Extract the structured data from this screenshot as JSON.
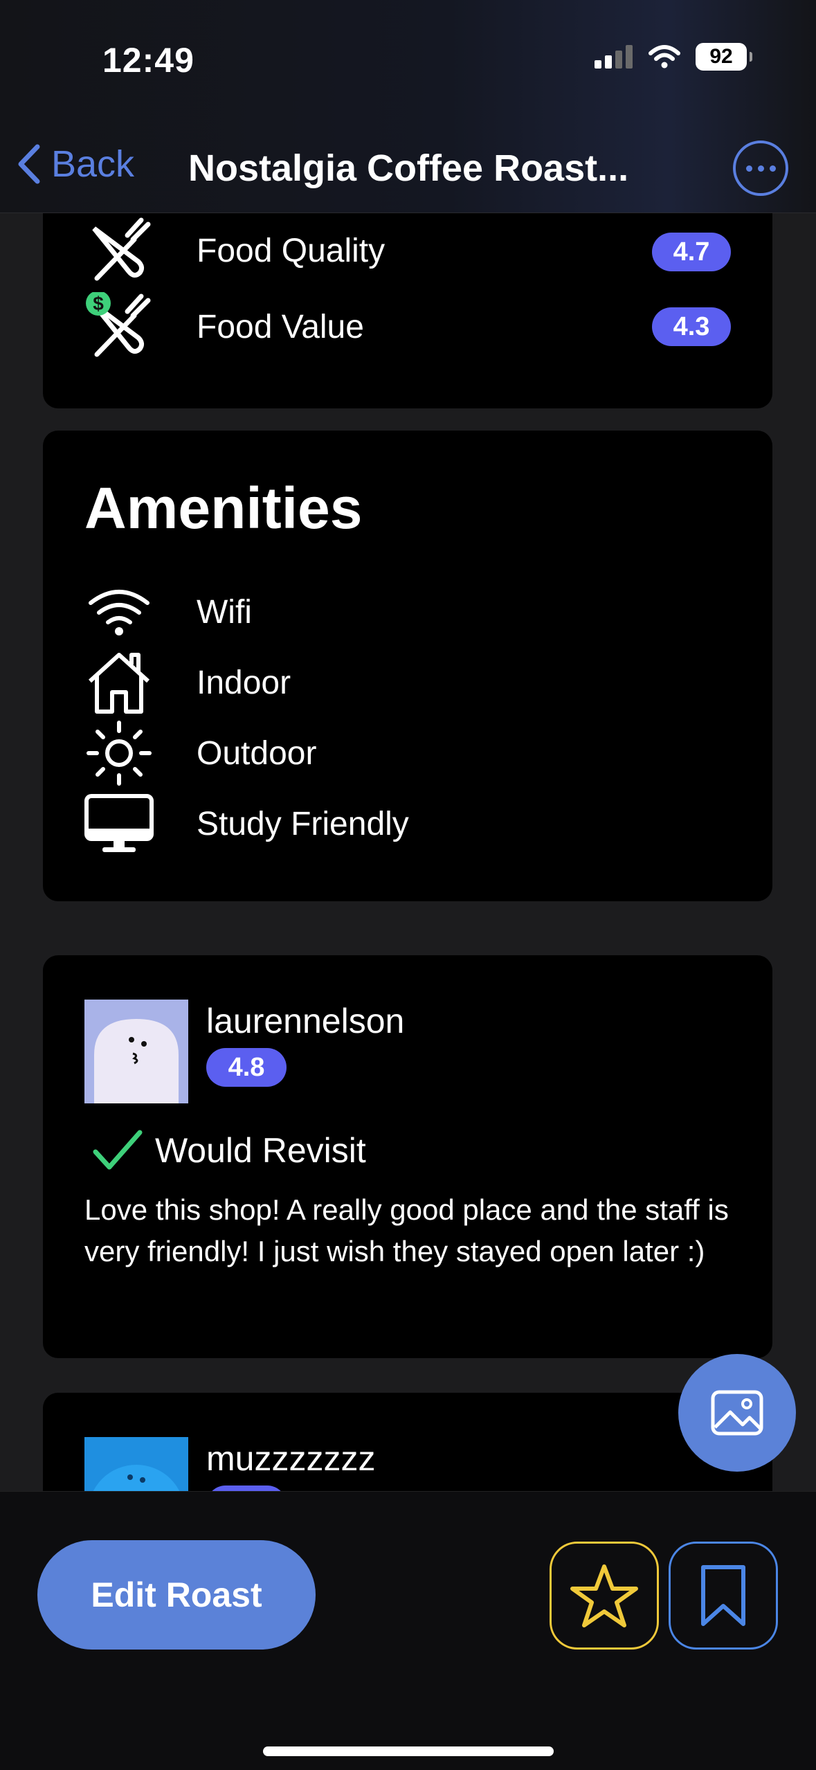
{
  "status_bar": {
    "time": "12:49",
    "battery": "92"
  },
  "nav": {
    "back_label": "Back",
    "title": "Nostalgia Coffee Roast..."
  },
  "ratings": [
    {
      "label": "Food Quality",
      "score": "4.7",
      "icon": "fork-knife-icon"
    },
    {
      "label": "Food Value",
      "score": "4.3",
      "icon": "fork-knife-dollar-icon"
    }
  ],
  "amenities": {
    "title": "Amenities",
    "items": [
      {
        "label": "Wifi",
        "icon": "wifi-icon"
      },
      {
        "label": "Indoor",
        "icon": "house-icon"
      },
      {
        "label": "Outdoor",
        "icon": "sun-icon"
      },
      {
        "label": "Study Friendly",
        "icon": "monitor-icon"
      }
    ]
  },
  "reviews": [
    {
      "username": "laurennelson",
      "score": "4.8",
      "revisit": "Would Revisit",
      "text": "Love this shop! A really good place and the staff is very friendly! I just wish they stayed open later :)",
      "avatar_color": "#a9b3e8"
    },
    {
      "username": "muzzzzzzz",
      "avatar_color": "#1f8fe0"
    }
  ],
  "actions": {
    "edit_label": "Edit Roast"
  },
  "colors": {
    "accent": "#5b82d8",
    "pill": "#5b5ff0",
    "star": "#f0c93a",
    "check": "#3ed07a"
  }
}
